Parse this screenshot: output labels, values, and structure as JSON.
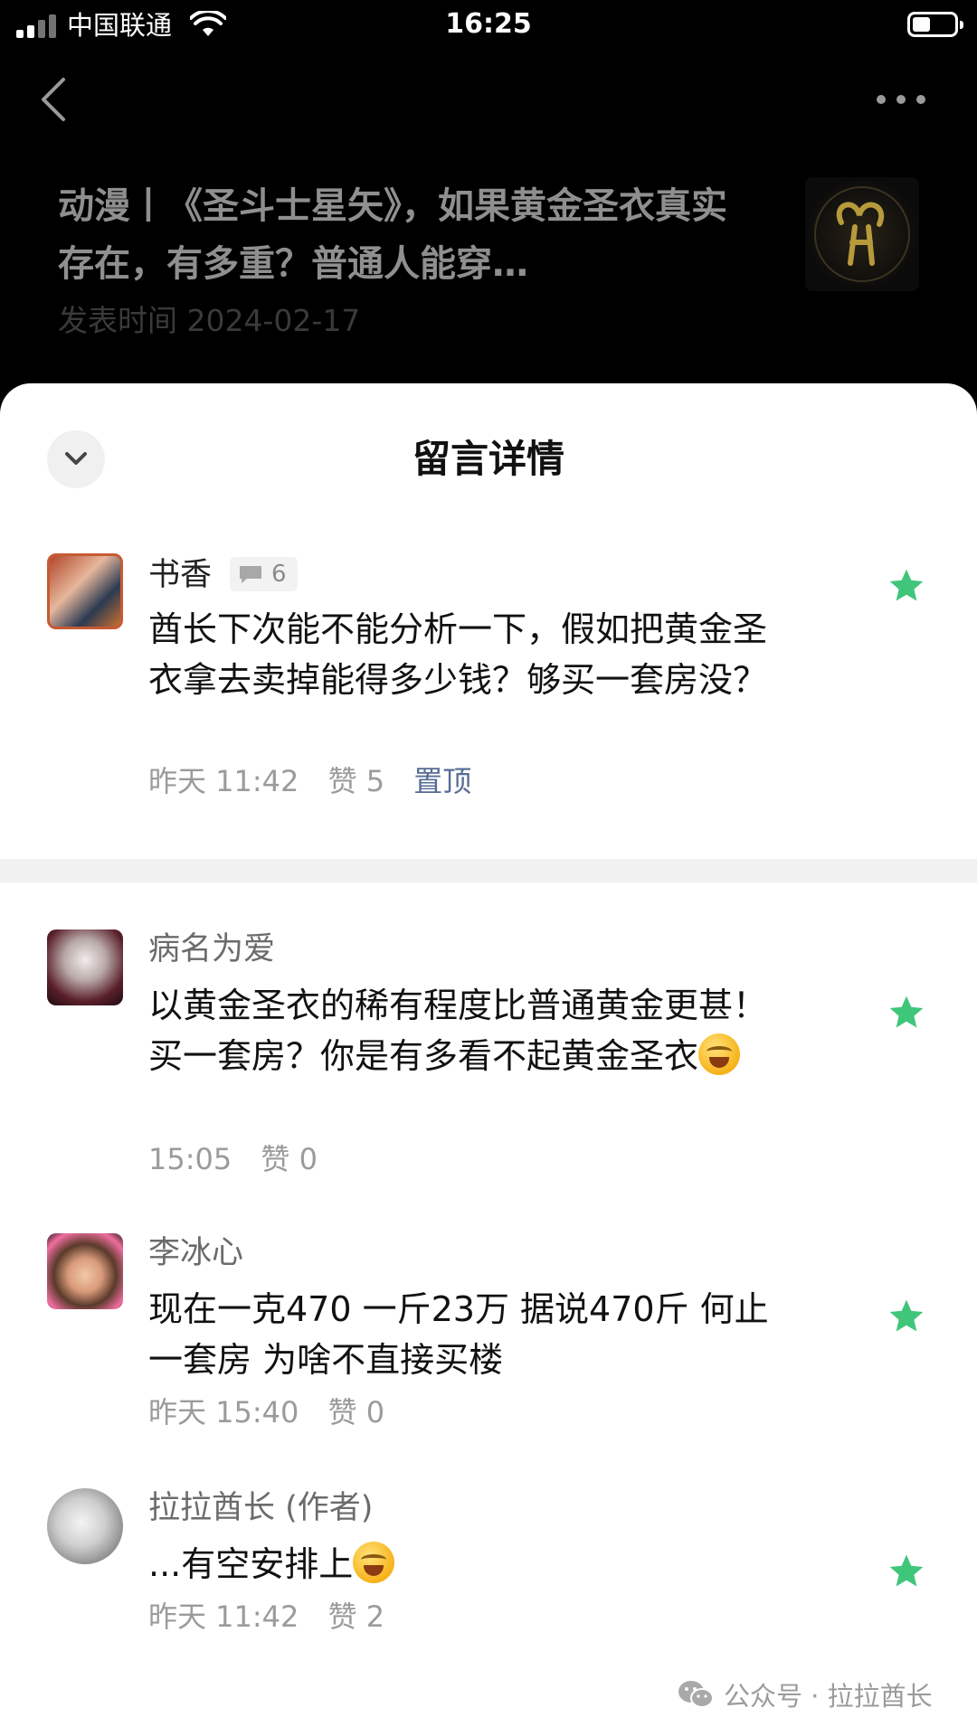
{
  "status_bar": {
    "carrier": "中国联通",
    "time": "16:25",
    "icons": [
      "signal-icon",
      "wifi-icon",
      "battery-icon"
    ]
  },
  "article": {
    "title": "动漫丨《圣斗士星矢》，如果黄金圣衣真实存在，有多重？普通人能穿…",
    "date": "发表时间 2024-02-17"
  },
  "sheet": {
    "title": "留言详情"
  },
  "comments": [
    {
      "name": "书香",
      "reply_count": "6",
      "text": "酋长下次能不能分析一下，假如把黄金圣衣拿去卖掉能得多少钱？够买一套房没？",
      "time": "昨天 11:42",
      "likes": "赞 5",
      "pin": "置顶"
    },
    {
      "name": "病名为爱",
      "text": "以黄金圣衣的稀有程度比普通黄金更甚！买一套房？你是有多看不起黄金圣衣",
      "emoji": "laugh-cry-emoji",
      "time": "15:05",
      "likes": "赞 0"
    },
    {
      "name": "李冰心",
      "text": "现在一克470 一斤23万 据说470斤 何止一套房 为啥不直接买楼",
      "time": "昨天 15:40",
      "likes": "赞 0"
    },
    {
      "name": "拉拉酋长 (作者)",
      "text": "...有空安排上",
      "emoji": "laugh-cry-emoji",
      "time": "昨天 11:42",
      "likes": "赞 2"
    }
  ],
  "watermark": {
    "text": "公众号 · 拉拉酋长"
  },
  "colors": {
    "star": "#3fc67a",
    "pin_link": "#576b95",
    "muted": "#9b9b9b"
  }
}
